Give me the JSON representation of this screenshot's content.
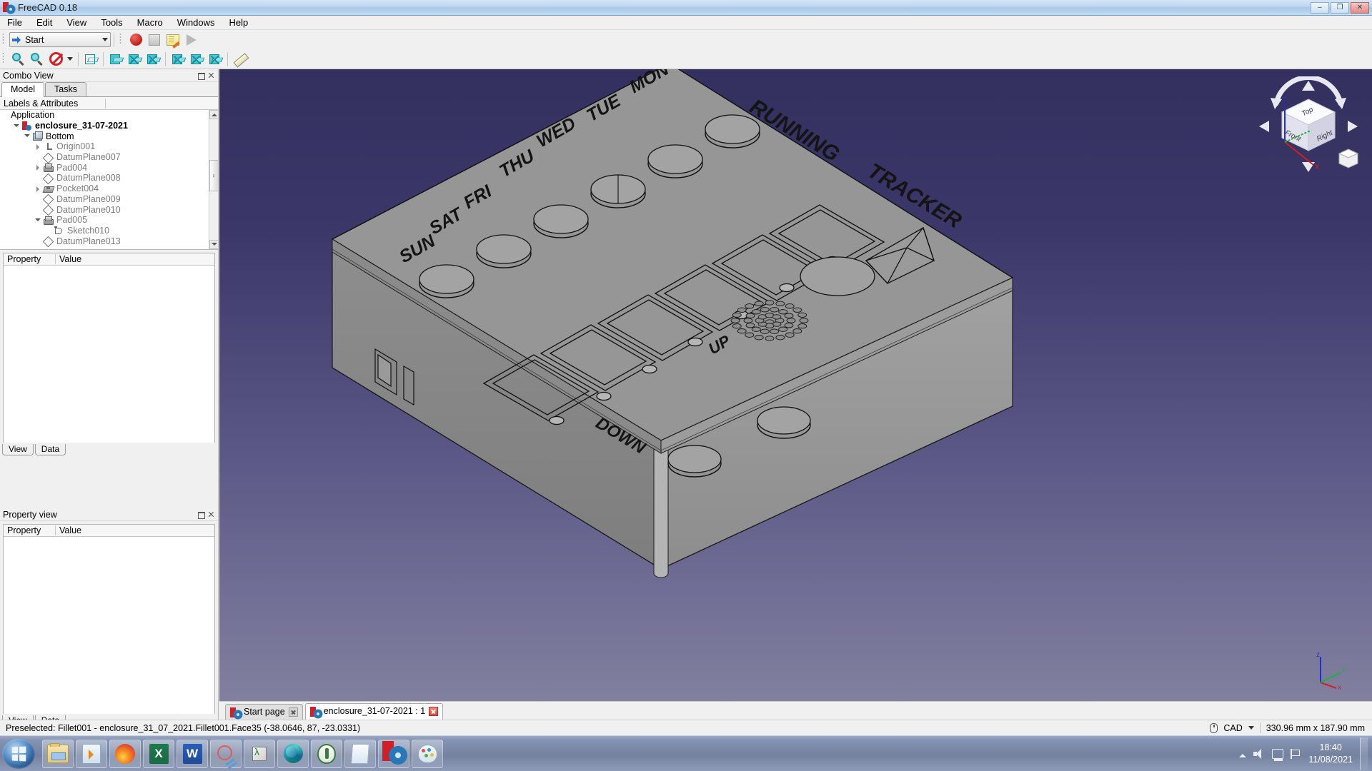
{
  "window": {
    "title": "FreeCAD 0.18",
    "app_icon": "freecad-logo-icon",
    "minimize_label": "–",
    "maximize_label": "❐",
    "close_label": "✕"
  },
  "menubar": {
    "items": [
      {
        "label": "File"
      },
      {
        "label": "Edit"
      },
      {
        "label": "View"
      },
      {
        "label": "Tools"
      },
      {
        "label": "Macro"
      },
      {
        "label": "Windows"
      },
      {
        "label": "Help"
      }
    ]
  },
  "toolbars": {
    "workbench": {
      "selected": "Start",
      "icon": "blue-arrow-icon",
      "dropdown_icon": "chevron-down-icon"
    },
    "macro": [
      {
        "name": "macro-record-button",
        "icon": "record-circle-icon",
        "label": "Macro recording"
      },
      {
        "name": "macro-stop-button",
        "icon": "stop-square-icon",
        "label": "Stop macro recording"
      },
      {
        "name": "macros-button",
        "icon": "notepad-pencil-icon",
        "label": "Macros"
      },
      {
        "name": "macro-execute-button",
        "icon": "play-triangle-icon",
        "label": "Execute macro"
      }
    ],
    "view": [
      {
        "name": "fit-all-button",
        "icon": "fit-all-icon",
        "label": "Fit all"
      },
      {
        "name": "fit-selection-button",
        "icon": "fit-selection-icon",
        "label": "Fit selection"
      },
      {
        "name": "draw-style-button",
        "icon": "no-entry-icon",
        "label": "Draw style"
      },
      {
        "name": "isometric-view-button",
        "icon": "isometric-cube-icon",
        "label": "Isometric"
      },
      {
        "name": "front-view-button",
        "icon": "front-cube-icon",
        "label": "Front"
      },
      {
        "name": "top-view-button",
        "icon": "top-cube-icon",
        "label": "Top"
      },
      {
        "name": "right-view-button",
        "icon": "right-cube-icon",
        "label": "Right"
      },
      {
        "name": "rear-view-button",
        "icon": "rear-cube-icon",
        "label": "Rear"
      },
      {
        "name": "bottom-view-button",
        "icon": "bottom-cube-icon",
        "label": "Bottom"
      },
      {
        "name": "left-view-button",
        "icon": "left-cube-icon",
        "label": "Left"
      },
      {
        "name": "measure-button",
        "icon": "ruler-icon",
        "label": "Measure"
      }
    ]
  },
  "combo_view": {
    "title": "Combo View",
    "float_icon": "float-panel-icon",
    "close_icon": "close-icon",
    "tabs": [
      {
        "label": "Model",
        "active": true
      },
      {
        "label": "Tasks",
        "active": false
      }
    ],
    "tree_columns": [
      "Labels & Attributes",
      ""
    ],
    "tree": [
      {
        "label": "Application",
        "depth": 0,
        "expander": "none",
        "icon": "none",
        "style": "root-app"
      },
      {
        "label": "enclosure_31-07-2021",
        "depth": 1,
        "expander": "open",
        "icon": "ti-doc",
        "style": "doc"
      },
      {
        "label": "Bottom",
        "depth": 2,
        "expander": "open",
        "icon": "ti-body",
        "style": "body-row"
      },
      {
        "label": "Origin001",
        "depth": 3,
        "expander": "closed",
        "icon": "ti-origin",
        "style": ""
      },
      {
        "label": "DatumPlane007",
        "depth": 3,
        "expander": "none",
        "icon": "ti-plane",
        "style": ""
      },
      {
        "label": "Pad004",
        "depth": 3,
        "expander": "closed",
        "icon": "ti-pad",
        "style": ""
      },
      {
        "label": "DatumPlane008",
        "depth": 3,
        "expander": "none",
        "icon": "ti-plane",
        "style": ""
      },
      {
        "label": "Pocket004",
        "depth": 3,
        "expander": "closed",
        "icon": "ti-pocket",
        "style": ""
      },
      {
        "label": "DatumPlane009",
        "depth": 3,
        "expander": "none",
        "icon": "ti-plane",
        "style": ""
      },
      {
        "label": "DatumPlane010",
        "depth": 3,
        "expander": "none",
        "icon": "ti-plane",
        "style": ""
      },
      {
        "label": "Pad005",
        "depth": 3,
        "expander": "open",
        "icon": "ti-pad",
        "style": ""
      },
      {
        "label": "Sketch010",
        "depth": 4,
        "expander": "none",
        "icon": "ti-sketch",
        "style": ""
      },
      {
        "label": "DatumPlane013",
        "depth": 3,
        "expander": "none",
        "icon": "ti-plane",
        "style": ""
      }
    ],
    "property_columns": [
      "Property",
      "Value"
    ],
    "bottom_tabs": [
      {
        "label": "View"
      },
      {
        "label": "Data"
      }
    ]
  },
  "property_view": {
    "title": "Property view",
    "float_icon": "float-panel-icon",
    "close_icon": "close-icon",
    "columns": [
      "Property",
      "Value"
    ],
    "bottom_tabs": [
      {
        "label": "View"
      },
      {
        "label": "Data"
      }
    ]
  },
  "view3d": {
    "nav_cube": {
      "top_face": "Top",
      "front_face": "Front",
      "right_face": "Right",
      "axis_z": "Z",
      "axis_x": "X",
      "axis_y": "Y",
      "corner_cube_icon": "view-cube-icon",
      "corner_menu_icon": "chevron-down-icon"
    },
    "axis_indicator": {
      "z": "z",
      "x": "x",
      "y": "y"
    },
    "model_labels": {
      "title": [
        "RUNNING",
        "TRACKER"
      ],
      "days": [
        "MON",
        "TUE",
        "WED",
        "THU",
        "FRI",
        "SAT",
        "SUN"
      ],
      "buttons": [
        "UP",
        "DOWN"
      ]
    },
    "background_top_color": "#332f5e",
    "background_bottom_color": "#82809f",
    "model_color": "#969696"
  },
  "view_tabs": [
    {
      "label": "Start page",
      "active": false,
      "close_icon": "close-icon",
      "icon": "freecad-logo-icon"
    },
    {
      "label": "enclosure_31-07-2021 : 1",
      "active": true,
      "close_icon": "close-icon",
      "icon": "freecad-logo-icon"
    }
  ],
  "statusbar": {
    "message": "Preselected: Fillet001 - enclosure_31_07_2021.Fillet001.Face35 (-38.0646, 87, -23.0331)",
    "nav_style": "CAD",
    "nav_icon": "mouse-icon",
    "nav_dropdown_icon": "chevron-down-icon",
    "dimensions": "330.96 mm x 187.90 mm"
  },
  "taskbar": {
    "start_label": "Start",
    "start_icon": "windows-orb-icon",
    "items": [
      {
        "name": "taskbar-file-explorer",
        "icon": "ti-folder",
        "label": "File Explorer",
        "text": ""
      },
      {
        "name": "taskbar-media-player",
        "icon": "ti-wmp",
        "label": "Windows Media Player",
        "text": ""
      },
      {
        "name": "taskbar-firefox",
        "icon": "ti-fox",
        "label": "Firefox",
        "text": ""
      },
      {
        "name": "taskbar-excel",
        "icon": "ti-excel",
        "label": "Excel",
        "text": "X"
      },
      {
        "name": "taskbar-word",
        "icon": "ti-word",
        "label": "Word",
        "text": "W"
      },
      {
        "name": "taskbar-snipping-tool",
        "icon": "ti-snip",
        "label": "Snipping Tool",
        "text": ""
      },
      {
        "name": "taskbar-3d-viewer",
        "icon": "ti-3dcube",
        "label": "3D Viewer",
        "text": ""
      },
      {
        "name": "taskbar-edge",
        "icon": "ti-edge",
        "label": "Microsoft Edge",
        "text": ""
      },
      {
        "name": "taskbar-tools",
        "icon": "ti-wrench",
        "label": "Tools",
        "text": ""
      },
      {
        "name": "taskbar-notepad",
        "icon": "ti-notepad",
        "label": "Notepad",
        "text": ""
      },
      {
        "name": "taskbar-freecad",
        "icon": "ti-freecad",
        "label": "FreeCAD",
        "text": ""
      },
      {
        "name": "taskbar-paint",
        "icon": "ti-paint",
        "label": "Paint",
        "text": ""
      }
    ],
    "tray": {
      "show_hidden_icon": "chevron-up-icon",
      "volume_icon": "speaker-icon",
      "network_icon": "network-icon",
      "action_center_icon": "flag-icon",
      "time": "18:40",
      "date": "11/08/2021"
    }
  }
}
